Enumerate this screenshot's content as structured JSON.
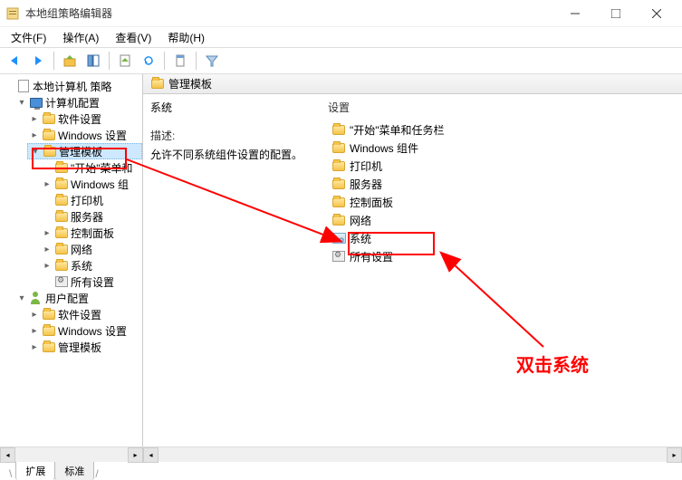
{
  "window": {
    "title": "本地组策略编辑器"
  },
  "menu": {
    "file": "文件(F)",
    "action": "操作(A)",
    "view": "查看(V)",
    "help": "帮助(H)"
  },
  "tree": {
    "root": "本地计算机 策略",
    "computerConfig": "计算机配置",
    "software": "软件设置",
    "windowsSettings": "Windows 设置",
    "adminTemplates": "管理模板",
    "startMenu": "\"开始\"菜单和",
    "windowsComp": "Windows 组",
    "printers": "打印机",
    "servers": "服务器",
    "controlPanel": "控制面板",
    "network": "网络",
    "system": "系统",
    "allSettings": "所有设置",
    "userConfig": "用户配置",
    "software2": "软件设置",
    "windowsSettings2": "Windows 设置",
    "adminTemplates2": "管理模板"
  },
  "right": {
    "header": "管理模板",
    "title": "系统",
    "descLabel": "描述:",
    "descText": "允许不同系统组件设置的配置。",
    "settingsHeader": "设置",
    "items": {
      "startMenu": "\"开始\"菜单和任务栏",
      "windowsComp": "Windows 组件",
      "printers": "打印机",
      "servers": "服务器",
      "controlPanel": "控制面板",
      "network": "网络",
      "system": "系统",
      "allSettings": "所有设置"
    }
  },
  "tabs": {
    "extended": "扩展",
    "standard": "标准"
  },
  "annotation": {
    "doubleClick": "双击系统"
  }
}
